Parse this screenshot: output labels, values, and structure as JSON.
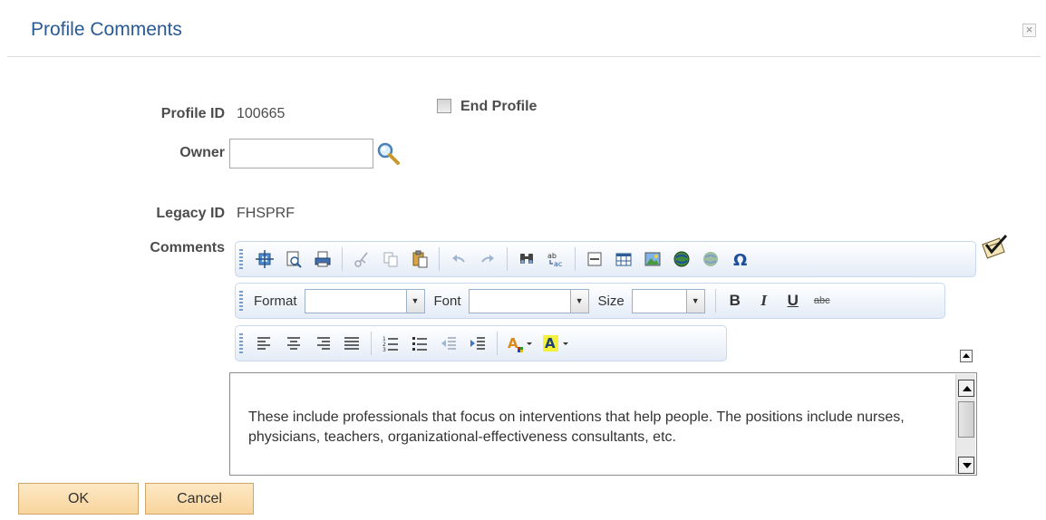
{
  "dialog": {
    "title": "Profile Comments",
    "close_glyph": "×"
  },
  "form": {
    "profile_id_label": "Profile ID",
    "profile_id_value": "100665",
    "end_profile_label": "End Profile",
    "end_profile_checked": false,
    "owner_label": "Owner",
    "owner_value": "",
    "legacy_id_label": "Legacy ID",
    "legacy_id_value": "FHSPRF",
    "comments_label": "Comments"
  },
  "editor": {
    "toolbar1_icons": [
      "source-icon",
      "preview-icon",
      "print-icon",
      "cut-icon",
      "copy-icon",
      "paste-icon",
      "undo-icon",
      "redo-icon",
      "find-icon",
      "replace-icon",
      "horizontal-rule-icon",
      "table-icon",
      "image-icon",
      "link-icon",
      "unlink-icon",
      "special-character-icon"
    ],
    "format_label": "Format",
    "format_value": "",
    "font_label": "Font",
    "font_value": "",
    "size_label": "Size",
    "size_value": "",
    "bold": "B",
    "italic": "I",
    "underline": "U",
    "strikethrough": "abc",
    "text_color_letter": "A",
    "bg_color_letter": "A",
    "content": "These include professionals that focus on interventions that help people. The positions include nurses, physicians, teachers, organizational-effectiveness consultants, etc."
  },
  "buttons": {
    "ok": "OK",
    "cancel": "Cancel"
  },
  "colors": {
    "title": "#2a5a94",
    "button_bg": "#fbe0b0",
    "toolbar_border": "#c8d8ee"
  }
}
